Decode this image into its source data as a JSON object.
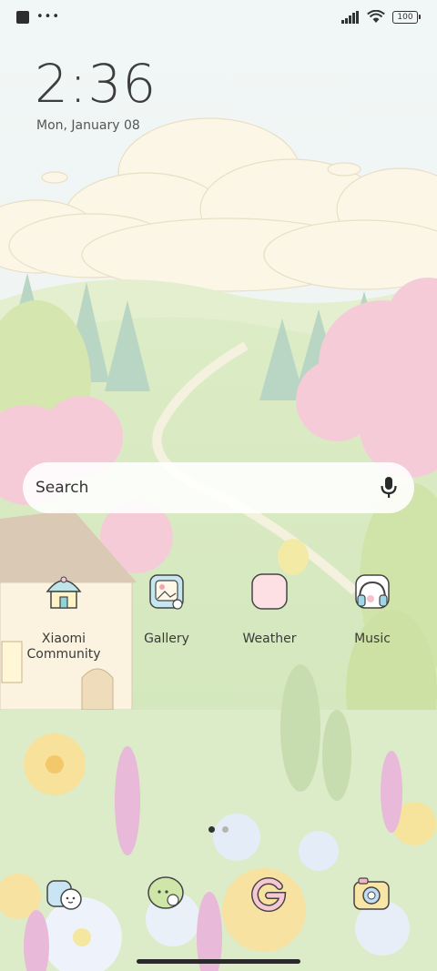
{
  "status_bar": {
    "battery": "100"
  },
  "lockscreen": {
    "time": "2:36",
    "date": "Mon, January 08"
  },
  "search": {
    "placeholder": "Search"
  },
  "apps": [
    {
      "label": "Xiaomi\nCommunity",
      "icon": "xiaomi-community-icon"
    },
    {
      "label": "Gallery",
      "icon": "gallery-icon"
    },
    {
      "label": "Weather",
      "icon": "weather-icon"
    },
    {
      "label": "Music",
      "icon": "music-icon"
    }
  ],
  "dock": [
    {
      "icon": "phone-icon"
    },
    {
      "icon": "messages-icon"
    },
    {
      "icon": "google-icon"
    },
    {
      "icon": "camera-icon"
    }
  ],
  "pager": {
    "current_page": 1,
    "total_pages": 2
  },
  "colors": {
    "sky": "#eef4f3",
    "grass": "#d6e8bf",
    "blossom": "#f6cbd8",
    "cloud": "#fbf7ea"
  }
}
